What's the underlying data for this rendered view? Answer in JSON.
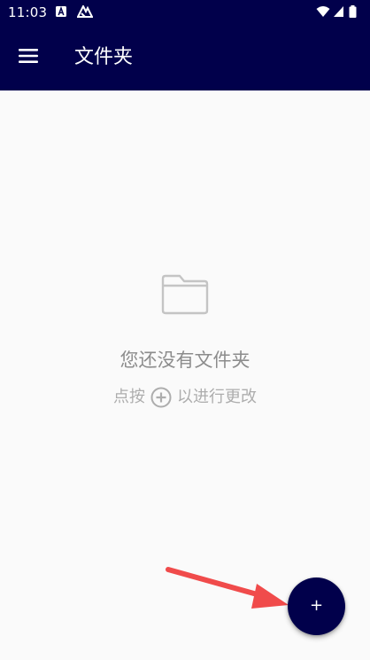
{
  "status_bar": {
    "time": "11:03",
    "icons": [
      "a-box-icon",
      "notification-app-icon",
      "wifi-icon",
      "signal-icon",
      "battery-icon"
    ]
  },
  "app_bar": {
    "title": "文件夹",
    "menu_icon": "hamburger-menu-icon"
  },
  "empty_state": {
    "icon": "folder-icon",
    "title": "您还没有文件夹",
    "hint_before": "点按",
    "hint_icon": "add-circle-icon",
    "hint_after": "以进行更改"
  },
  "fab": {
    "label": "+",
    "icon": "plus-icon"
  },
  "annotation": {
    "icon": "red-arrow-icon",
    "color": "#F04B4B"
  },
  "colors": {
    "primary": "#01004B",
    "background": "#FAFAFA",
    "text_title": "#8C8C8C",
    "text_hint": "#ADADAD",
    "arrow": "#F04B4B"
  }
}
